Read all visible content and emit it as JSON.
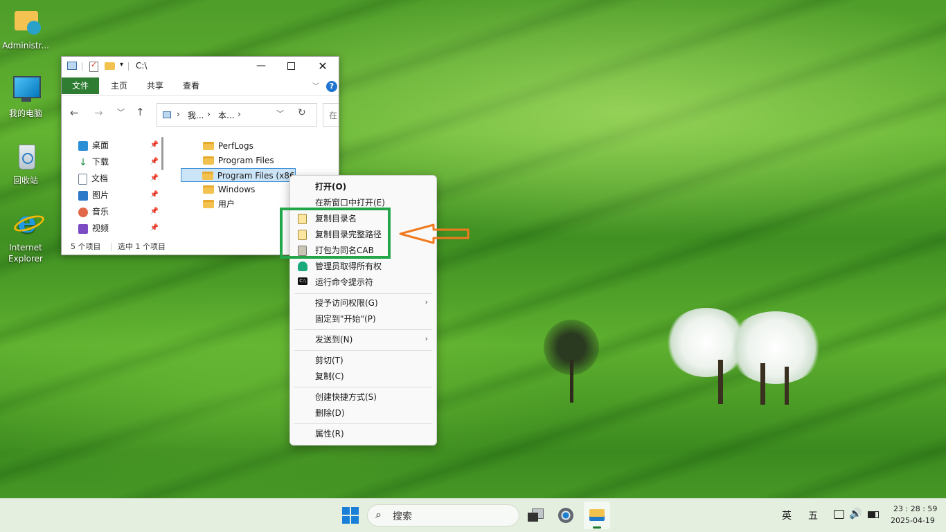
{
  "desktop": {
    "icons": [
      {
        "label": "Administr..."
      },
      {
        "label": "我的电脑"
      },
      {
        "label": "回收站"
      },
      {
        "label": "Internet Explorer"
      }
    ]
  },
  "explorer": {
    "title": "C:\\",
    "tabs": [
      "文件",
      "主页",
      "共享",
      "查看"
    ],
    "breadcrumb": [
      "我...",
      "本..."
    ],
    "search_placeholder": "在",
    "sidebar": [
      {
        "label": "桌面",
        "color": "#2d8fd6"
      },
      {
        "label": "下载",
        "color": "#1b8f45"
      },
      {
        "label": "文档",
        "color": "#6f7f91"
      },
      {
        "label": "图片",
        "color": "#2c78c9"
      },
      {
        "label": "音乐",
        "color": "#e0674a"
      },
      {
        "label": "视频",
        "color": "#7a4bc2"
      }
    ],
    "files": [
      "PerfLogs",
      "Program Files",
      "Program Files (x86)",
      "Windows",
      "用户"
    ],
    "status": {
      "count": "5 个项目",
      "selected": "选中 1 个项目"
    }
  },
  "context_menu": {
    "items": [
      {
        "label": "打开(O)",
        "bold": true
      },
      {
        "label": "在新窗口中打开(E)"
      },
      {
        "label": "复制目录名"
      },
      {
        "label": "复制目录完整路径"
      },
      {
        "label": "打包为同名CAB"
      },
      {
        "label": "管理员取得所有权"
      },
      {
        "label": "运行命令提示符"
      },
      {
        "label": "授予访问权限(G)"
      },
      {
        "label": "固定到\"开始\"(P)"
      },
      {
        "label": "发送到(N)"
      },
      {
        "label": "剪切(T)"
      },
      {
        "label": "复制(C)"
      },
      {
        "label": "创建快捷方式(S)"
      },
      {
        "label": "删除(D)"
      },
      {
        "label": "属性(R)"
      }
    ]
  },
  "annotation": {
    "box_color": "#23a64a",
    "arrow_color": "#f07a1e"
  },
  "taskbar": {
    "search_label": "搜索",
    "ime_lang": "英",
    "ime_mode": "五",
    "time": "23 : 28 : 59",
    "date": "2025-04-19"
  }
}
